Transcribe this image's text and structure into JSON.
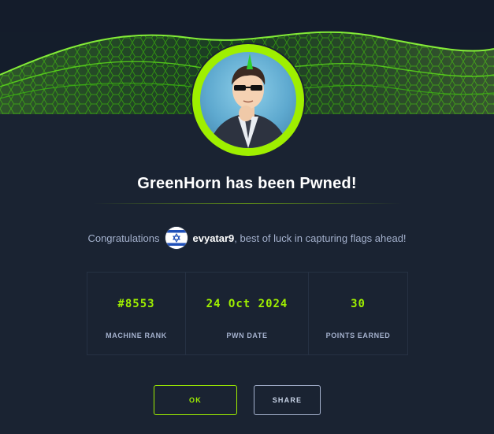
{
  "banner": {
    "style": "green-hex-grid-wave"
  },
  "avatar": {
    "description_icon": "hacker-avatar"
  },
  "title": "GreenHorn has been Pwned!",
  "congrats": {
    "prefix": "Congratulations",
    "flag_icon": "israel-flag-icon",
    "username": "evyatar9",
    "suffix": ", best of luck in capturing flags ahead!"
  },
  "stats": [
    {
      "value": "#8553",
      "label": "MACHINE RANK"
    },
    {
      "value": "24 Oct 2024",
      "label": "PWN DATE"
    },
    {
      "value": "30",
      "label": "POINTS EARNED"
    }
  ],
  "buttons": {
    "ok": "OK",
    "share": "SHARE"
  },
  "colors": {
    "background": "#1a2332",
    "accent": "#9fef00",
    "muted_text": "#a4b1cd"
  }
}
